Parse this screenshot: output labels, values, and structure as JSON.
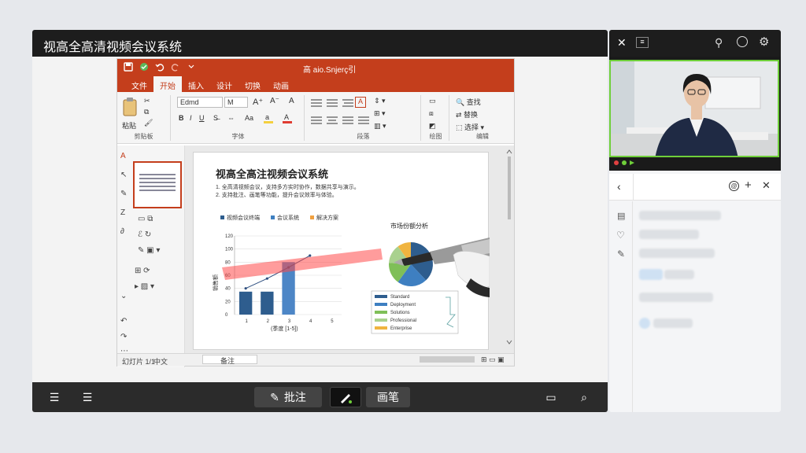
{
  "app": {
    "title": "视高全高清视频会议系统"
  },
  "ppt": {
    "doc_title": "高 aio.Snjerç引",
    "tabs": [
      "文件",
      "开始",
      "插入",
      "设计",
      "切换",
      "动画"
    ],
    "active_tab": 1,
    "font_name": "Edmd",
    "font_size": "M",
    "group_labels": [
      "剪贴板",
      "字体",
      "段落",
      "绘图",
      "编辑"
    ],
    "paste_label": "粘贴",
    "bold": "B",
    "italic": "I",
    "underline": "U",
    "draw_items": [
      "形状",
      "排列",
      "快速样式"
    ],
    "edit_items": [
      "查找",
      "替换",
      "选择"
    ],
    "statusbar": {
      "left": "幻灯片 1/1",
      "lang": "中文",
      "notes": "备注"
    }
  },
  "slide": {
    "title": "视高全高注视频会议系统",
    "body_lines": [
      "1. 全高清视频会议，支持多方实时协作，数据共享与演示。",
      "2. 支持批注、画笔等功能，提升会议效率与体验。"
    ],
    "legend_top": [
      "视频会议终端",
      "会议系统",
      "解决方案"
    ],
    "pie_title": "市场份额分析",
    "pie_legend": [
      "Standard",
      "Deployment",
      "Solutions",
      "Professional",
      "Enterprise"
    ]
  },
  "chart_data": {
    "type": "bar",
    "categories": [
      "1",
      "2",
      "3",
      "4",
      "5"
    ],
    "series": [
      {
        "values": [
          35,
          35,
          80,
          0,
          0
        ]
      },
      {
        "values": [
          40,
          55,
          72,
          90,
          0
        ]
      }
    ],
    "ylim": [
      0,
      120
    ],
    "yticks": [
      "120",
      "100",
      "80",
      "60",
      "40",
      "20",
      "0"
    ],
    "xticks": [
      "1",
      "2",
      "3",
      "4",
      "5"
    ],
    "ylabel": "销售额",
    "xlabel": "(季度 [1-5])"
  },
  "pie_data": {
    "type": "pie",
    "values": [
      38,
      22,
      16,
      14,
      10
    ],
    "colors": [
      "#2e5d8e",
      "#3e7fc1",
      "#7fbf58",
      "#a9d18e",
      "#f0b440"
    ]
  },
  "toolbar": {
    "annotate": "批注",
    "pen": "画笔"
  },
  "colors": {
    "accent": "#c43e1c",
    "green": "#6fcf3a",
    "dark": "#1d1d1d"
  }
}
